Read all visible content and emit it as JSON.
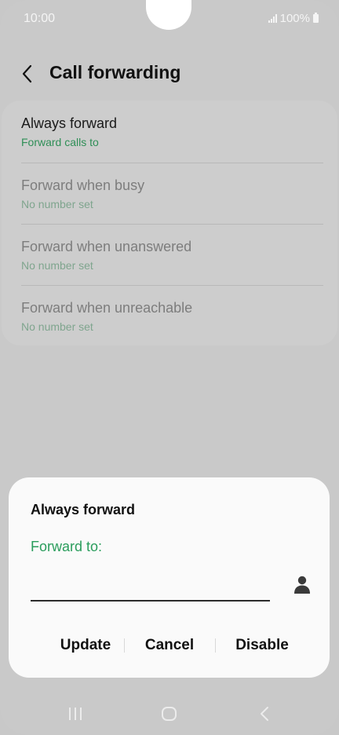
{
  "status_bar": {
    "time": "10:00",
    "battery": "100%"
  },
  "header": {
    "title": "Call forwarding"
  },
  "settings_list": [
    {
      "title": "Always forward",
      "subtitle": "Forward calls to",
      "enabled": true
    },
    {
      "title": "Forward when busy",
      "subtitle": "No number set",
      "enabled": false
    },
    {
      "title": "Forward when unanswered",
      "subtitle": "No number set",
      "enabled": false
    },
    {
      "title": "Forward when unreachable",
      "subtitle": "No number set",
      "enabled": false
    }
  ],
  "dialog": {
    "title": "Always forward",
    "field_label": "Forward to:",
    "field_value": "",
    "buttons": {
      "update": "Update",
      "cancel": "Cancel",
      "disable": "Disable"
    }
  },
  "colors": {
    "accent": "#2a9d5c",
    "dim_accent": "#7fa58e",
    "background": "#c9c9c9",
    "dialog": "#fafafa"
  },
  "icons": {
    "back": "chevron-left-icon",
    "contact": "person-icon",
    "nav_recent": "recent-apps-icon",
    "nav_home": "home-icon",
    "nav_back": "back-icon"
  }
}
